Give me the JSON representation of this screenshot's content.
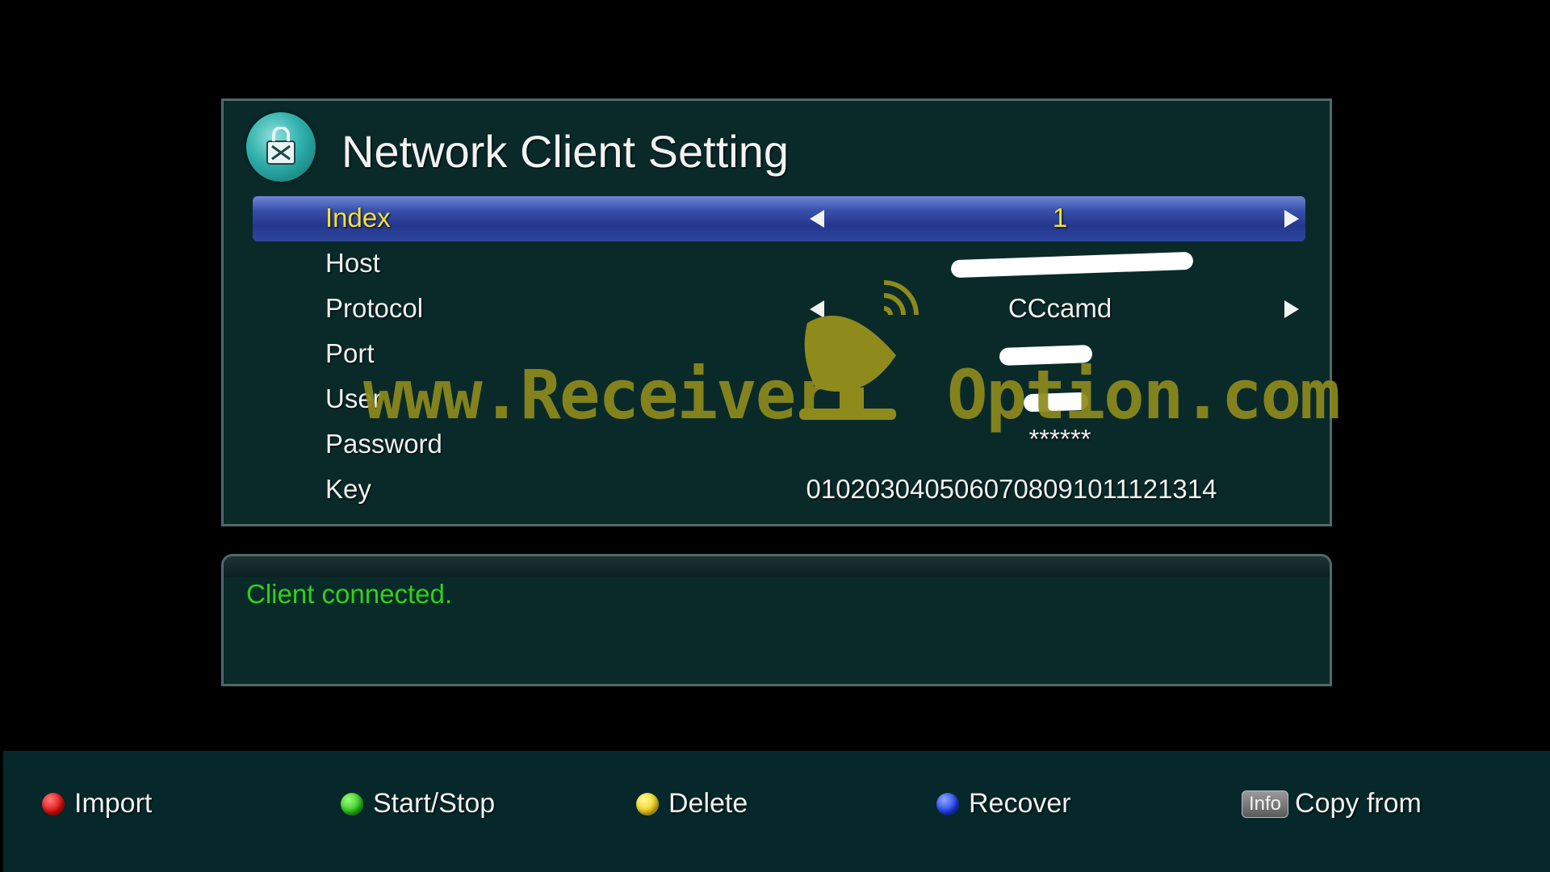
{
  "window": {
    "title": "Network Client Setting",
    "icon": "network-client-icon"
  },
  "settings": [
    {
      "label": "Index",
      "value": "1",
      "has_arrows": true,
      "selected": true
    },
    {
      "label": "Host",
      "value": "",
      "has_arrows": false,
      "selected": false
    },
    {
      "label": "Protocol",
      "value": "CCcamd",
      "has_arrows": true,
      "selected": false
    },
    {
      "label": "Port",
      "value": "",
      "has_arrows": false,
      "selected": false
    },
    {
      "label": "User",
      "value": "",
      "has_arrows": false,
      "selected": false
    },
    {
      "label": "Password",
      "value": "******",
      "has_arrows": false,
      "selected": false
    },
    {
      "label": "Key",
      "value": "0102030405060708091011121314",
      "has_arrows": false,
      "selected": false
    }
  ],
  "watermark": {
    "left": "www.Receiver",
    "right": "Option.com"
  },
  "status": {
    "message": "Client connected."
  },
  "footer": {
    "import": {
      "label": "Import",
      "color": "#e01010"
    },
    "start_stop": {
      "label": "Start/Stop",
      "color": "#2fc81e"
    },
    "delete": {
      "label": "Delete",
      "color": "#f2d21a"
    },
    "recover": {
      "label": "Recover",
      "color": "#2040e8"
    },
    "info_key": "Info",
    "copy_from": {
      "label": "Copy from"
    }
  }
}
